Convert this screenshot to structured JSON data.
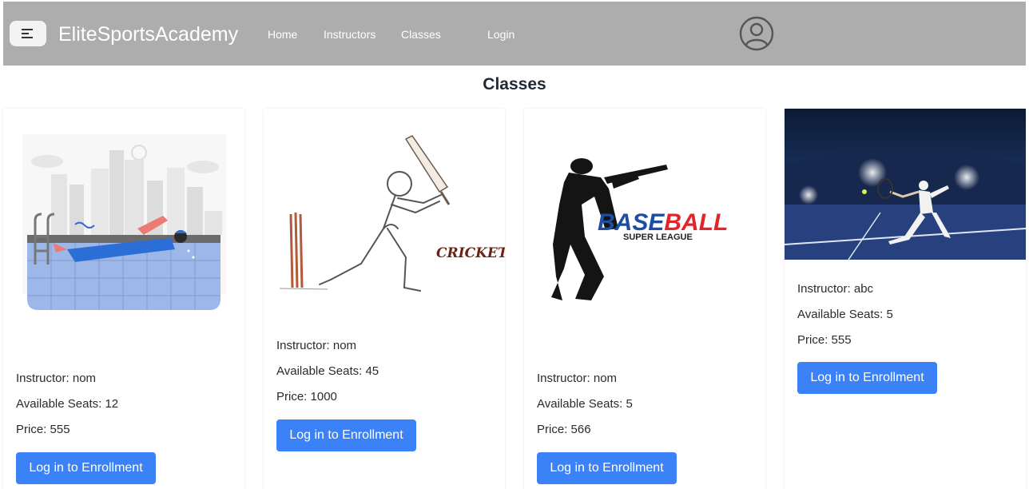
{
  "navbar": {
    "brand": "EliteSportsAcademy",
    "links": [
      "Home",
      "Instructors",
      "Classes",
      "Login"
    ]
  },
  "page": {
    "title": "Classes"
  },
  "colors": {
    "navbar_bg": "#adadad",
    "button_bg": "#3b82f6"
  },
  "classes": [
    {
      "image": "swimming-illustration",
      "instructor": "Instructor: nom",
      "seats": "Available Seats: 12",
      "price": "Price: 555",
      "button": "Log in to Enrollment"
    },
    {
      "image": "cricket-sketch",
      "image_text": "CRICKET",
      "instructor": "Instructor: nom",
      "seats": "Available Seats: 45",
      "price": "Price: 1000",
      "button": "Log in to Enrollment"
    },
    {
      "image": "baseball-logo",
      "image_text": [
        "BASEBALL",
        "SUPER LEAGUE"
      ],
      "instructor": "Instructor: nom",
      "seats": "Available Seats: 5",
      "price": "Price: 566",
      "button": "Log in to Enrollment"
    },
    {
      "image": "tennis-photo",
      "instructor": "Instructor: abc",
      "seats": "Available Seats: 5",
      "price": "Price: 555",
      "button": "Log in to Enrollment"
    }
  ]
}
